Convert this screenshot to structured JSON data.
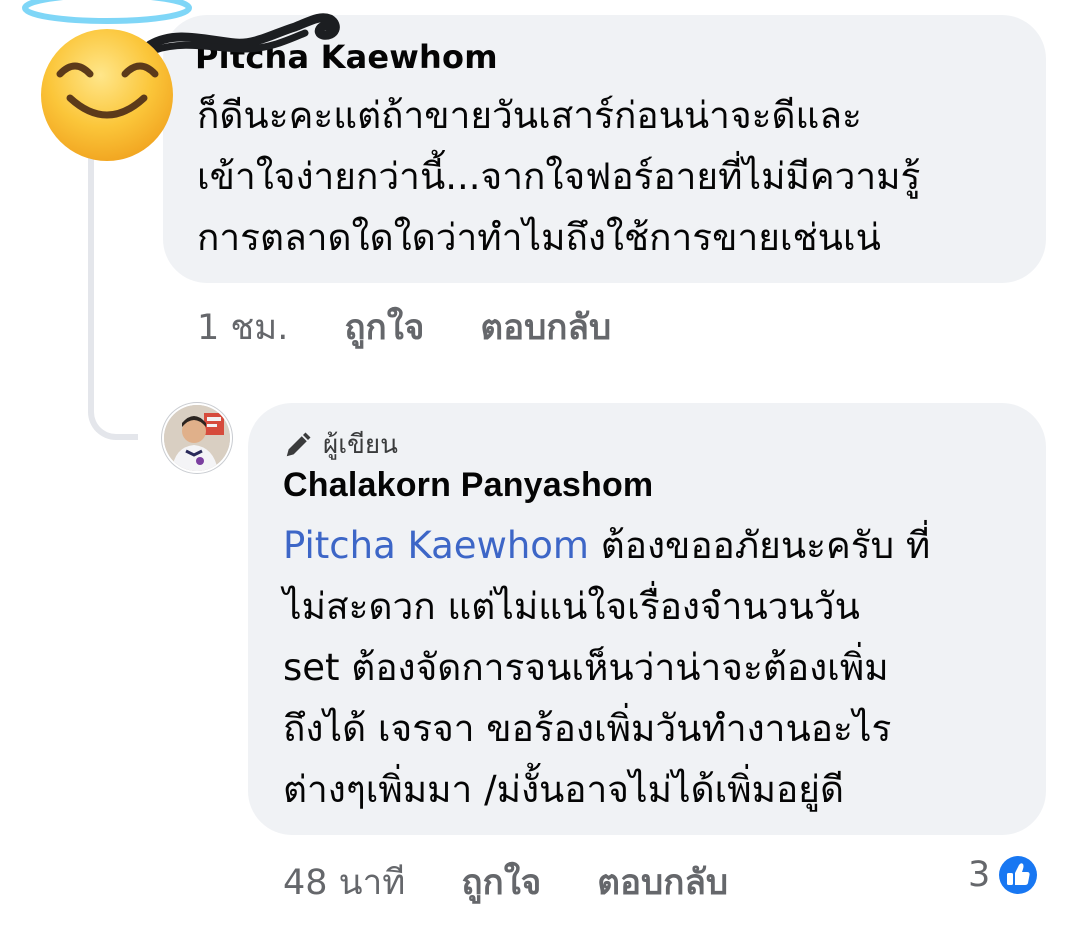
{
  "comment1": {
    "author": "Pitcha Kaewhom",
    "lines": [
      "ก็ดีนะคะแต่ถ้าขายวันเสาร์ก่อนน่าจะดีและ",
      "เข้าใจง่ายกว่านี้...จากใจฟอร์อายที่ไม่มีความรู้",
      "การตลาดใดใดว่าทำไมถึงใช้การขายเช่นเน่"
    ],
    "time": "1 ชม.",
    "like_label": "ถูกใจ",
    "reply_label": "ตอบกลับ",
    "avatar_icon": "smiling-face-with-halo-icon"
  },
  "comment2": {
    "badge_label": "ผู้เขียน",
    "author": "Chalakorn Panyashom",
    "mention": "Pitcha Kaewhom",
    "line1_rest": " ต้องขออภัยนะครับ ที่",
    "lines": [
      "ไม่สะดวก แต่ไม่แน่ใจเรื่องจำนวนวัน",
      "set ต้องจัดการจนเห็นว่าน่าจะต้องเพิ่ม",
      "ถึงได้ เจรจา ขอร้องเพิ่มวันทำงานอะไร",
      "ต่างๆเพิ่มมา /ม่งั้นอาจไม่ได้เพิ่มอยู่ดี"
    ],
    "time": "48 นาที",
    "like_label": "ถูกใจ",
    "reply_label": "ตอบกลับ",
    "reaction_count": "3",
    "reaction_icon": "like-thumb-icon"
  },
  "colors": {
    "bubble": "#f0f2f5",
    "mention": "#3d66c7",
    "meta": "#65676b",
    "like_blue": "#1877f2"
  }
}
